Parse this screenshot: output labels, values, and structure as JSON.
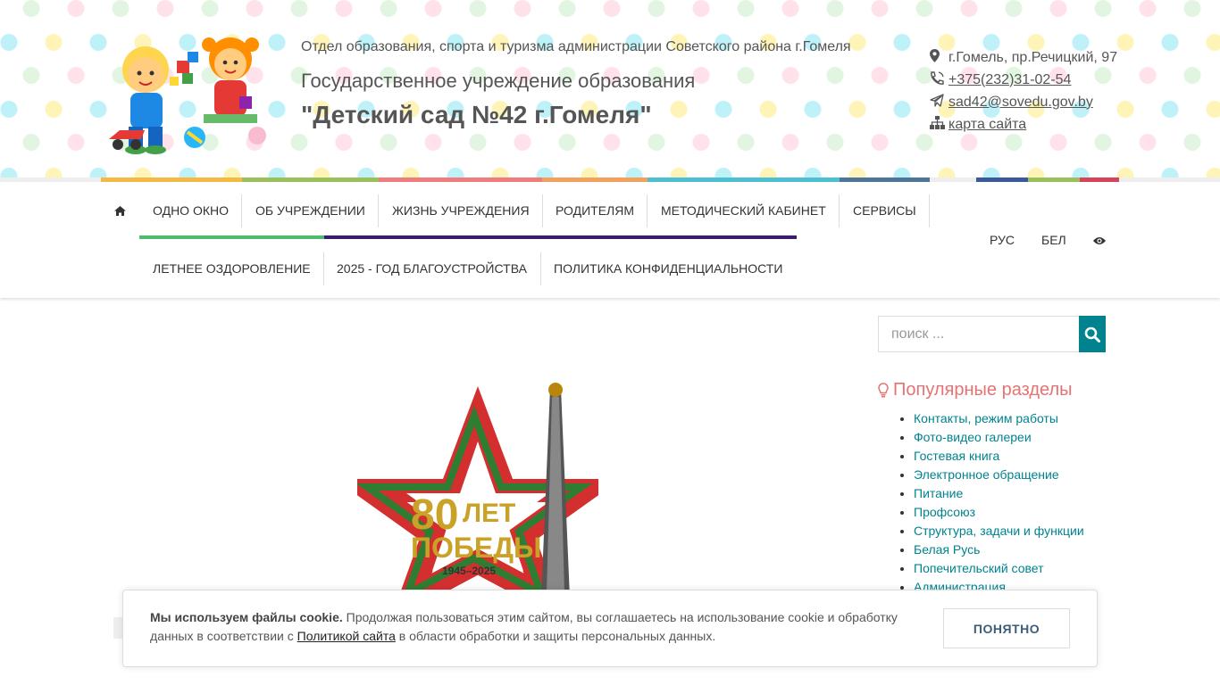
{
  "header": {
    "org": "Отдел образования, спорта и туризма администрации Советского района г.Гомеля",
    "institution": "Государственное учреждение образования",
    "name": "\"Детский сад №42 г.Гомеля\"",
    "address": "г.Гомель, пр.Речицкий, 97",
    "phone": "+375(232)31-02-54",
    "email": "sad42@sovedu.gov.by",
    "sitemap": "карта сайта"
  },
  "nav": {
    "row1": [
      "ОДНО ОКНО",
      "ОБ УЧРЕЖДЕНИИ",
      "ЖИЗНЬ УЧРЕЖДЕНИЯ",
      "РОДИТЕЛЯМ",
      "МЕТОДИЧЕСКИЙ КАБИНЕТ",
      "СЕРВИСЫ"
    ],
    "row2": [
      "ЛЕТНЕЕ ОЗДОРОВЛЕНИЕ",
      "2025 - ГОД БЛАГОУСТРОЙСТВА",
      "ПОЛИТИКА КОНФИДЕНЦИАЛЬНОСТИ"
    ],
    "lang_ru": "РУС",
    "lang_be": "БЕЛ"
  },
  "search": {
    "placeholder": "поиск ..."
  },
  "popular": {
    "title": "Популярные разделы",
    "items": [
      "Контакты, режим работы",
      "Фото-видео галереи",
      "Гостевая книга",
      "Электронное обращение",
      "Питание",
      "Профсоюз",
      "Структура, задачи и функции",
      "Белая Русь",
      "Попечительский совет",
      "Администрация"
    ]
  },
  "emblem": {
    "line1": "80",
    "line1b": "ЛЕТ",
    "line2": "ПОБЕДЫ",
    "years": "1945–2025"
  },
  "cookie": {
    "bold": "Мы используем файлы cookie.",
    "text1": " Продолжая пользоваться этим сайтом, вы соглашаетесь на использование cookie и обработку данных в соответствии с ",
    "link": "Политикой сайта",
    "text2": " в области обработки и защиты персональных данных.",
    "button": "ПОНЯТНО"
  },
  "colors": {
    "accent": "#00838f",
    "popular_title": "#e57373",
    "green": "#4cbb6c",
    "purple": "#3a1d6e"
  }
}
